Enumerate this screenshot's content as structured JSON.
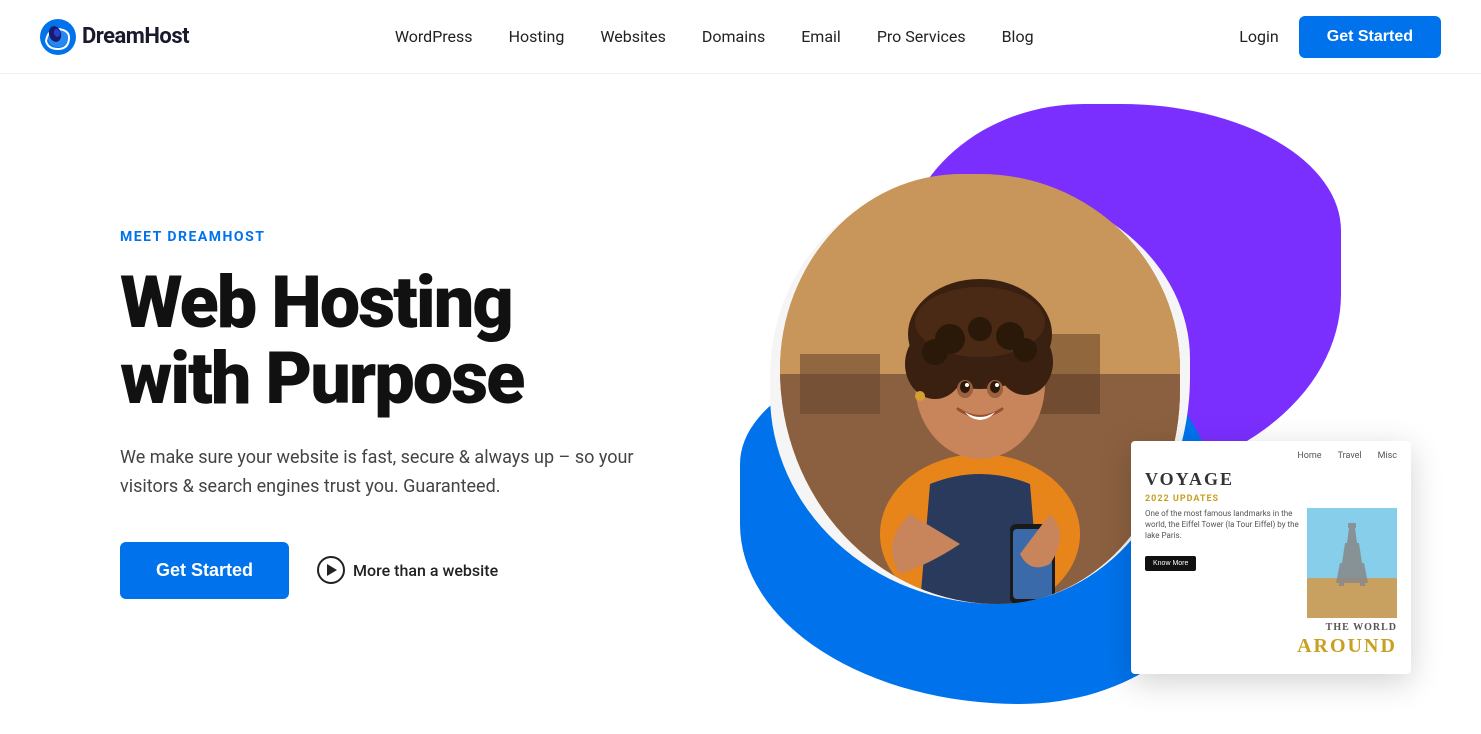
{
  "brand": {
    "name": "DreamHost",
    "logo_alt": "DreamHost logo"
  },
  "nav": {
    "links": [
      {
        "label": "WordPress",
        "id": "wordpress"
      },
      {
        "label": "Hosting",
        "id": "hosting"
      },
      {
        "label": "Websites",
        "id": "websites"
      },
      {
        "label": "Domains",
        "id": "domains"
      },
      {
        "label": "Email",
        "id": "email"
      },
      {
        "label": "Pro Services",
        "id": "pro-services"
      },
      {
        "label": "Blog",
        "id": "blog"
      }
    ],
    "login_label": "Login",
    "cta_label": "Get Started"
  },
  "hero": {
    "eyebrow": "MEET DREAMHOST",
    "title_line1": "Web Hosting",
    "title_line2": "with Purpose",
    "subtitle": "We make sure your website is fast, secure & always up – so your visitors & search engines trust you. Guaranteed.",
    "cta_label": "Get Started",
    "more_label": "More than a website"
  },
  "voyage_card": {
    "title": "VOYAGE",
    "nav_items": [
      "Home",
      "Travel",
      "Misc"
    ],
    "updates_label": "2022 UPDATES",
    "body_text": "One of the most famous landmarks in the world, the Eiffel Tower (la Tour Eiffel) by the lake Paris.",
    "btn_label": "Know More",
    "the_world": "THE WORLD",
    "around": "AROUND"
  }
}
